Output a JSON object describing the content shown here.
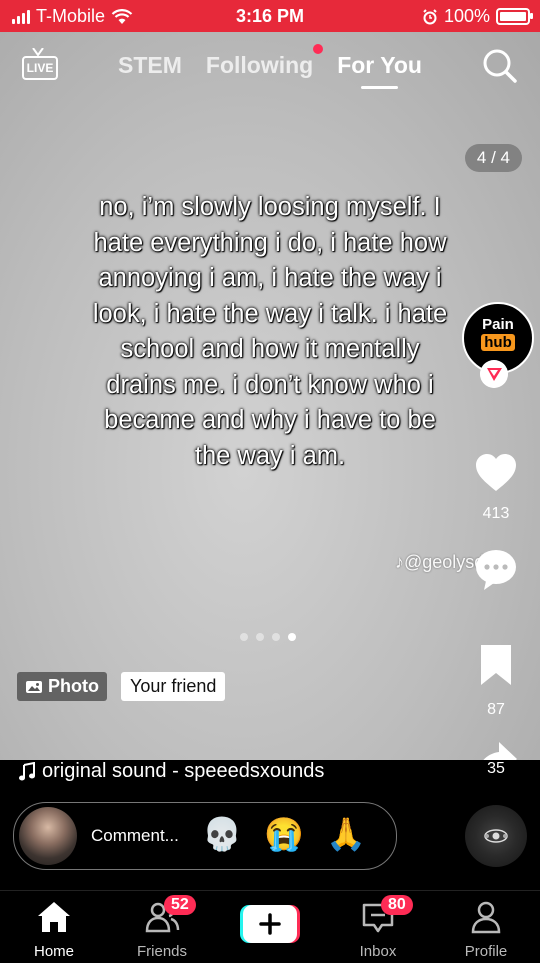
{
  "status_bar": {
    "carrier": "T-Mobile",
    "time": "3:16 PM",
    "battery": "100%"
  },
  "top_nav": {
    "live_label": "LIVE",
    "tabs": [
      {
        "label": "STEM"
      },
      {
        "label": "Following"
      },
      {
        "label": "For You"
      }
    ]
  },
  "post": {
    "counter": "4 / 4",
    "caption": "no, i’m slowly loosing myself. I hate everything i do, i hate how annoying i am, i hate the way i look, i hate the way i talk. i hate school and how it mentally drains me. i don’t know who i became and why i have to be the way i am.",
    "watermark": "@geolysddot",
    "photo_tag": "Photo",
    "friend_tag": "Your friend"
  },
  "creator": {
    "avatar_line1": "Pain",
    "avatar_line2": "hub"
  },
  "actions": {
    "likes": "413",
    "bookmarks": "87",
    "shares": "35"
  },
  "sound": "original sound - speeedsxounds",
  "comment_bar": {
    "placeholder": "Comment...",
    "emojis": [
      "💀",
      "😭",
      "🙏"
    ]
  },
  "bottom_nav": {
    "items": [
      {
        "label": "Home"
      },
      {
        "label": "Friends",
        "badge": "52"
      },
      {
        "label": "Inbox",
        "badge": "80"
      },
      {
        "label": "Profile"
      }
    ]
  },
  "colors": {
    "status_bar": "#e7293a",
    "badge": "#fe2c55",
    "hub_orange": "#f7971d"
  }
}
